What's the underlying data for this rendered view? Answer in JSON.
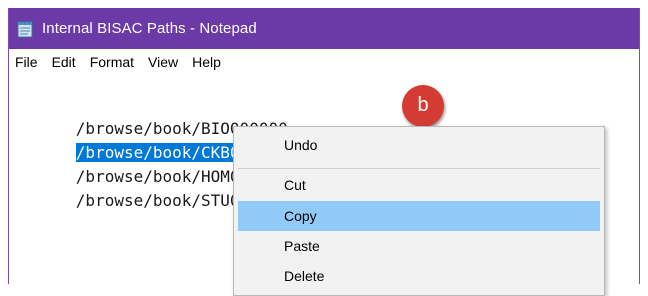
{
  "window": {
    "title": "Internal BISAC Paths - Notepad",
    "title_bar_color": "#6b3aa6",
    "icon": "notepad-icon"
  },
  "menubar": {
    "items": [
      "File",
      "Edit",
      "Format",
      "View",
      "Help"
    ]
  },
  "editor": {
    "lines": [
      "/browse/book/BIO000000",
      "/browse/book/CKB000000",
      "/browse/book/HOM0000",
      "/browse/book/STU0000"
    ],
    "selected_line_index": 1,
    "selection_color": "#0078d7"
  },
  "badge": {
    "label": "b",
    "color": "#d33b33"
  },
  "context_menu": {
    "items": [
      "Undo",
      "Cut",
      "Copy",
      "Paste",
      "Delete"
    ],
    "highlighted_item": "Copy",
    "highlight_color": "#91c9f7"
  }
}
